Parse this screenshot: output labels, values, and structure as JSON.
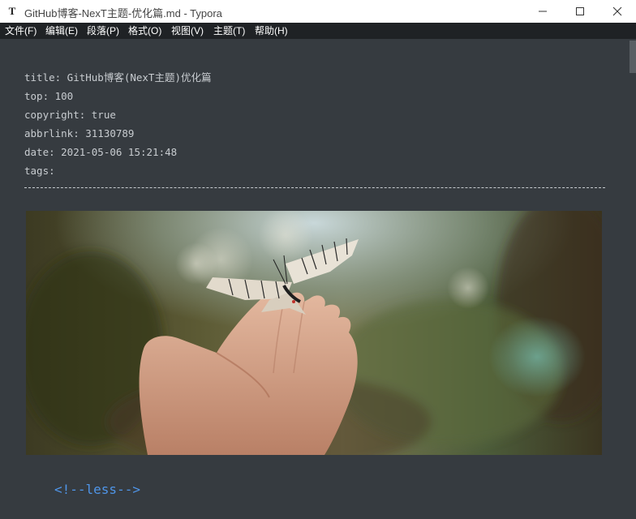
{
  "window": {
    "title": "GitHub博客-NexT主题-优化篇.md - Typora",
    "app_icon_letter": "T"
  },
  "menu": {
    "items": [
      {
        "label": "文件(F)"
      },
      {
        "label": "编辑(E)"
      },
      {
        "label": "段落(P)"
      },
      {
        "label": "格式(O)"
      },
      {
        "label": "视图(V)"
      },
      {
        "label": "主题(T)"
      },
      {
        "label": "帮助(H)"
      }
    ]
  },
  "front_matter": {
    "lines": [
      "title: GitHub博客(NexT主题)优化篇",
      "top: 100",
      "copyright: true",
      "abbrlink: 31130789",
      "date: 2021-05-06 15:21:48",
      "tags:"
    ]
  },
  "image": {
    "alt": "",
    "icon": "butterfly-on-hand-photo"
  },
  "body": {
    "less_marker": "<!--less-->"
  },
  "colors": {
    "editor_bg": "#363b40",
    "menubar_bg": "#1f2225",
    "text": "#c8ccd0",
    "accent": "#4f95e8"
  }
}
